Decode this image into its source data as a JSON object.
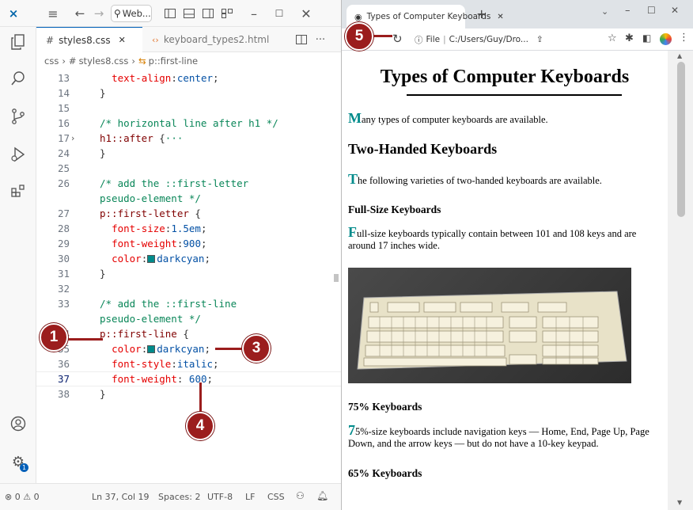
{
  "vscode": {
    "title_search": "Web...",
    "tabs": [
      {
        "label": "styles8.css",
        "close": "✕"
      },
      {
        "label": "keyboard_types2.html"
      }
    ],
    "breadcrumb": {
      "folder": "css",
      "file": "styles8.css",
      "symbol": "p::first-line"
    },
    "code_lines": [
      {
        "n": "13",
        "parts": [
          [
            "punc",
            "  "
          ],
          [
            "prop",
            "text-align"
          ],
          [
            "punc",
            ":"
          ],
          [
            "val",
            "center"
          ],
          [
            "punc",
            ";"
          ]
        ]
      },
      {
        "n": "14",
        "parts": [
          [
            "punc",
            "}"
          ]
        ]
      },
      {
        "n": "15",
        "parts": []
      },
      {
        "n": "16",
        "parts": [
          [
            "cmt",
            "/* horizontal line after h1 */"
          ]
        ]
      },
      {
        "n": "17",
        "parts": [
          [
            "sel",
            "h1::after"
          ],
          [
            "punc",
            " {"
          ],
          [
            "cmt",
            "···"
          ]
        ]
      },
      {
        "n": "24",
        "parts": [
          [
            "punc",
            "}"
          ]
        ]
      },
      {
        "n": "25",
        "parts": []
      },
      {
        "n": "26",
        "parts": [
          [
            "cmt",
            "/* add the ::first-letter"
          ]
        ]
      },
      {
        "n": "",
        "parts": [
          [
            "cmt",
            "pseudo-element */"
          ]
        ]
      },
      {
        "n": "27",
        "parts": [
          [
            "sel",
            "p::first-letter"
          ],
          [
            "punc",
            " {"
          ]
        ]
      },
      {
        "n": "28",
        "parts": [
          [
            "punc",
            "  "
          ],
          [
            "prop",
            "font-size"
          ],
          [
            "punc",
            ":"
          ],
          [
            "val",
            "1.5em"
          ],
          [
            "punc",
            ";"
          ]
        ]
      },
      {
        "n": "29",
        "parts": [
          [
            "punc",
            "  "
          ],
          [
            "prop",
            "font-weight"
          ],
          [
            "punc",
            ":"
          ],
          [
            "val",
            "900"
          ],
          [
            "punc",
            ";"
          ]
        ]
      },
      {
        "n": "30",
        "parts": [
          [
            "punc",
            "  "
          ],
          [
            "prop",
            "color"
          ],
          [
            "punc",
            ":"
          ],
          [
            "swatch",
            ""
          ],
          [
            "val",
            "darkcyan"
          ],
          [
            "punc",
            ";"
          ]
        ]
      },
      {
        "n": "31",
        "parts": [
          [
            "punc",
            "}"
          ]
        ]
      },
      {
        "n": "32",
        "parts": []
      },
      {
        "n": "33",
        "parts": [
          [
            "cmt",
            "/* add the ::first-line"
          ]
        ]
      },
      {
        "n": "",
        "parts": [
          [
            "cmt",
            "pseudo-element */"
          ]
        ]
      },
      {
        "n": "34",
        "parts": [
          [
            "sel",
            "p::first-line"
          ],
          [
            "punc",
            " {"
          ]
        ]
      },
      {
        "n": "35",
        "parts": [
          [
            "punc",
            "  "
          ],
          [
            "prop",
            "color"
          ],
          [
            "punc",
            ":"
          ],
          [
            "swatch",
            ""
          ],
          [
            "val",
            "darkcyan"
          ],
          [
            "punc",
            ";"
          ]
        ]
      },
      {
        "n": "36",
        "parts": [
          [
            "punc",
            "  "
          ],
          [
            "prop",
            "font-style"
          ],
          [
            "punc",
            ":"
          ],
          [
            "val",
            "italic"
          ],
          [
            "punc",
            ";"
          ]
        ]
      },
      {
        "n": "37",
        "parts": [
          [
            "punc",
            "  "
          ],
          [
            "prop",
            "font-weight"
          ],
          [
            "punc",
            ": "
          ],
          [
            "val",
            "600"
          ],
          [
            "punc",
            ";"
          ]
        ]
      },
      {
        "n": "38",
        "parts": [
          [
            "punc",
            "}"
          ]
        ]
      }
    ],
    "status": {
      "problems": "⊗ 0 ⚠ 0",
      "position": "Ln 37, Col 19",
      "spaces": "Spaces: 2",
      "encoding": "UTF-8",
      "eol": "LF",
      "language": "CSS"
    }
  },
  "callouts": [
    "1",
    "3",
    "4",
    "5"
  ],
  "browser": {
    "tab_title": "Types of Computer Keyboards",
    "tab_close": "✕",
    "new_tab": "+",
    "address_label": "File",
    "address": "C:/Users/Guy/Dro...",
    "page": {
      "h1": "Types of Computer Keyboards",
      "p1_first": "M",
      "p1_rest": "any types of computer keyboards are available.",
      "h2": "Two-Handed Keyboards",
      "p2_first": "T",
      "p2_rest": "he following varieties of two-handed keyboards are available.",
      "h3a": "Full-Size Keyboards",
      "p3_first": "F",
      "p3_rest": "ull-size keyboards typically contain between 101 and 108 keys and are around 17 inches wide.",
      "h3b": "75% Keyboards",
      "p4_first": "7",
      "p4_rest": "5%-size keyboards include navigation keys — Home, End, Page Up, Page Down, and the arrow keys — but do not have a 10-key keypad.",
      "h3c": "65% Keyboards"
    }
  },
  "colors": {
    "accent": "#008b8b",
    "callout": "#9b1d1d"
  }
}
